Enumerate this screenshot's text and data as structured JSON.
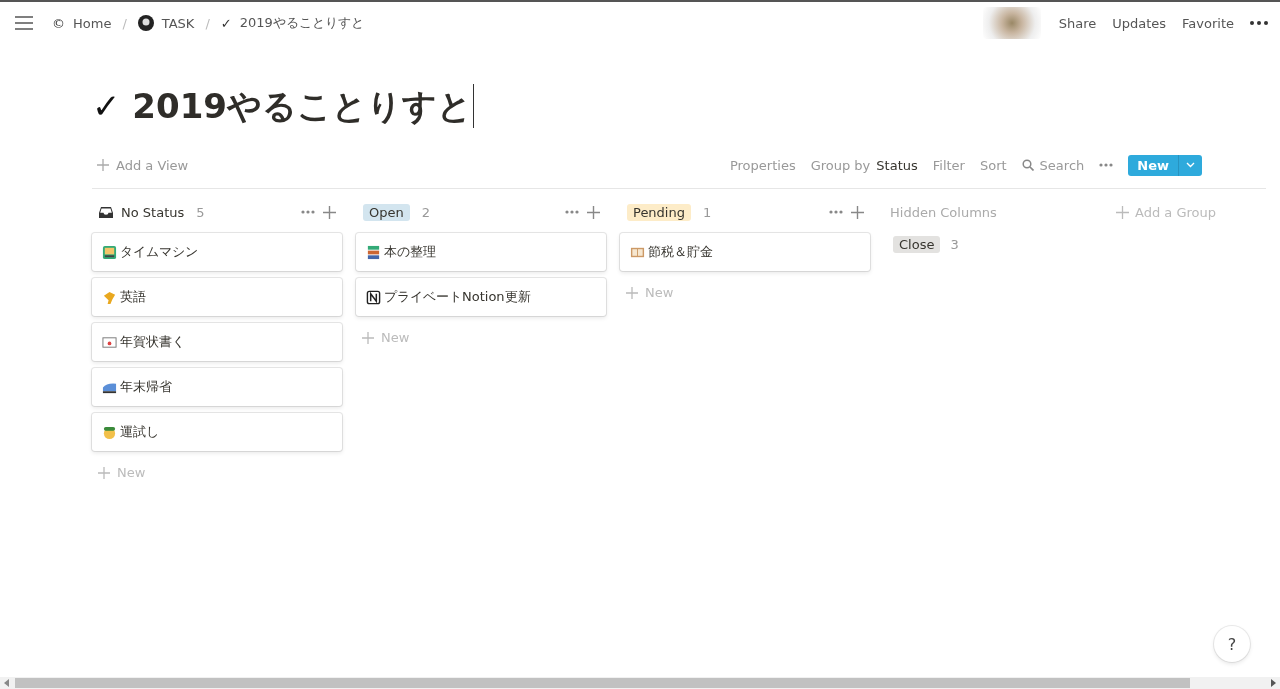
{
  "topbar": {
    "separator": "/",
    "breadcrumbs": [
      {
        "glyph": "©",
        "label": "Home"
      },
      {
        "label": "TASK"
      },
      {
        "glyph": "✓",
        "label": "2019やることりすと"
      }
    ],
    "actions": [
      "Share",
      "Updates",
      "Favorite"
    ]
  },
  "page": {
    "glyph": "✓",
    "title": "2019やることりすと"
  },
  "toolbar": {
    "add_view": "Add a View",
    "properties": "Properties",
    "group_by": "Group by",
    "group_field": "Status",
    "filter": "Filter",
    "sort": "Sort",
    "search": "Search",
    "new_button": "New"
  },
  "columns": [
    {
      "label": "No Status",
      "kind": "inbox",
      "count": "5",
      "cards": [
        "タイムマシン",
        "英語",
        "年賀状書く",
        "年末帰省",
        "運試し"
      ],
      "new_label": "New"
    },
    {
      "label": "Open",
      "kind": "tag",
      "color": "#d3e5ef",
      "count": "2",
      "cards": [
        "本の整理",
        "プライベートNotion更新"
      ],
      "new_label": "New"
    },
    {
      "label": "Pending",
      "kind": "tag",
      "color": "#fdecc8",
      "count": "1",
      "cards": [
        "節税＆貯金"
      ],
      "new_label": "New"
    }
  ],
  "hidden_columns": {
    "title": "Hidden Columns",
    "items": [
      {
        "label": "Close",
        "color": "#e3e2e0",
        "count": "3"
      }
    ]
  },
  "add_group": "Add a Group",
  "help": "?"
}
